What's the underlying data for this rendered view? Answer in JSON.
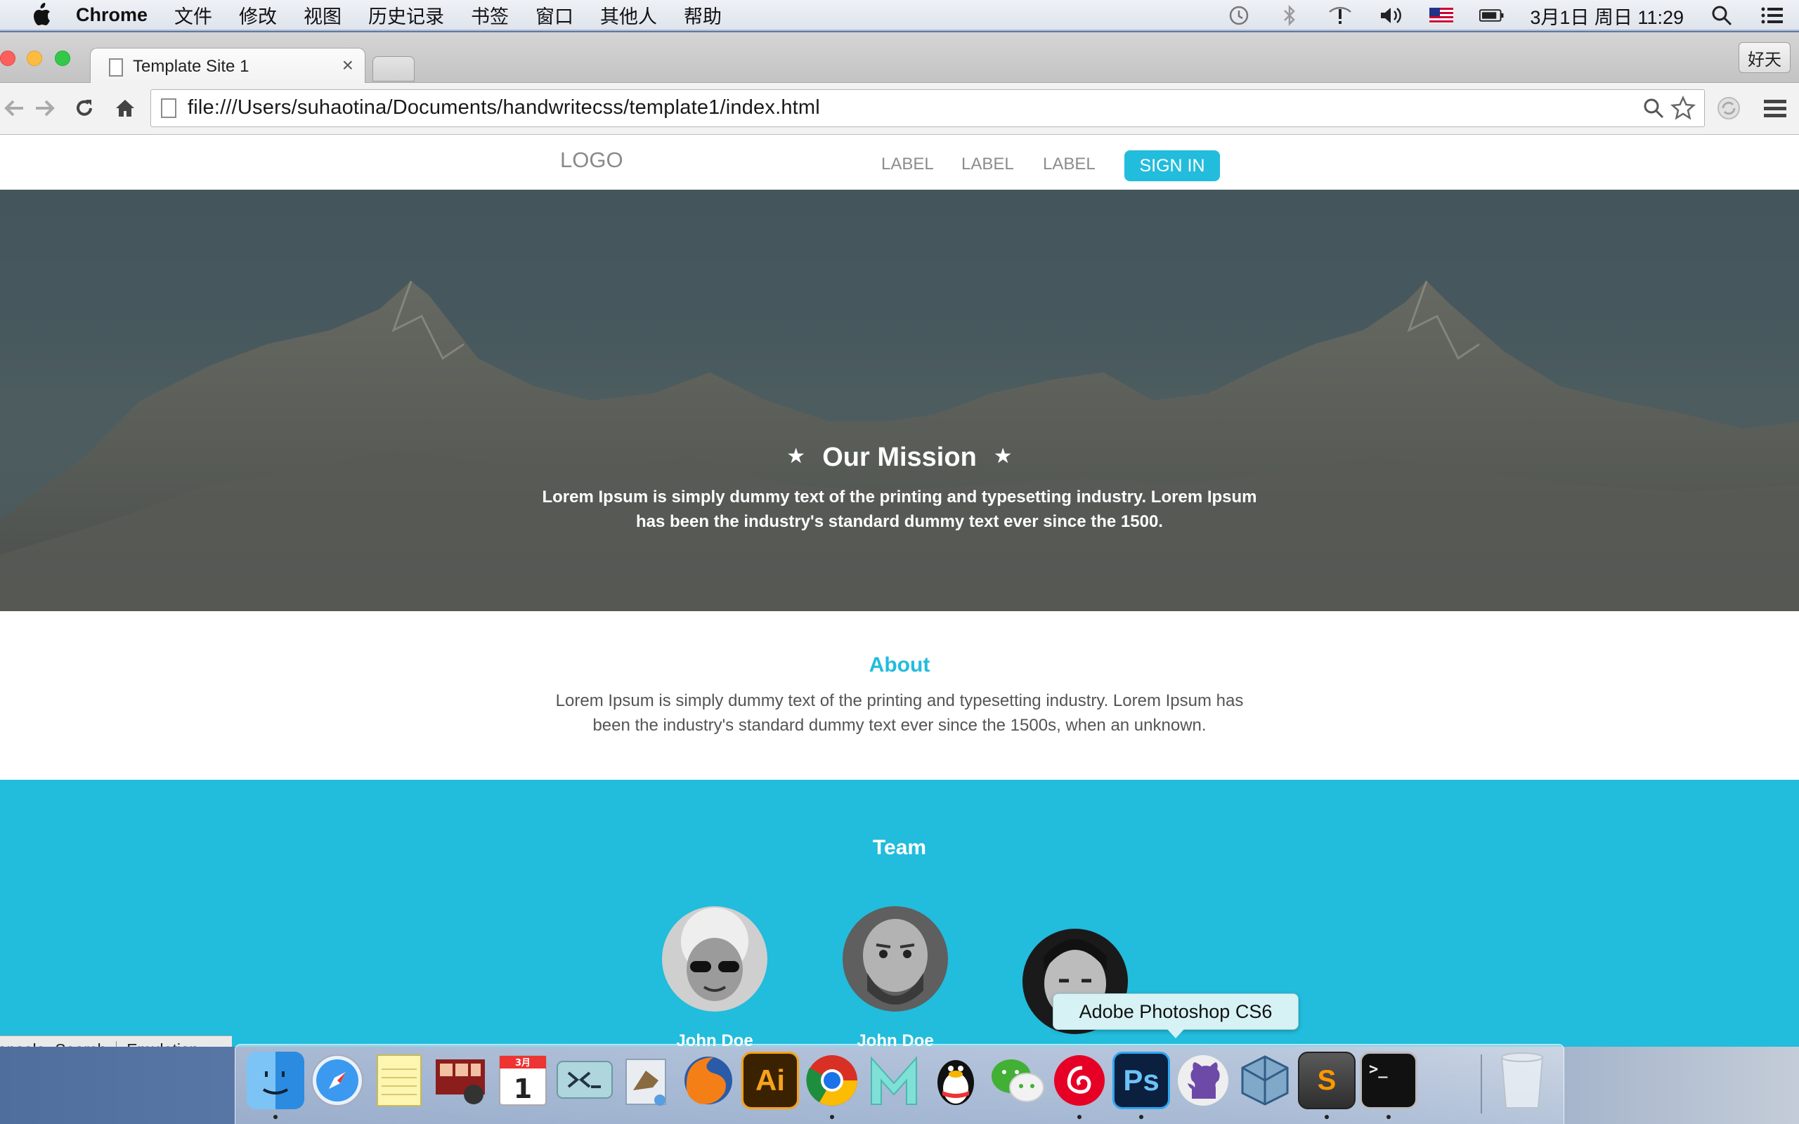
{
  "menubar": {
    "app_name": "Chrome",
    "items": [
      "文件",
      "修改",
      "视图",
      "历史记录",
      "书签",
      "窗口",
      "其他人",
      "帮助"
    ],
    "clock": "3月1日 周日 11:29"
  },
  "browser": {
    "tab_title": "Template Site 1",
    "profile_button": "好天",
    "url": "file:///Users/suhaotina/Documents/handwritecss/template1/index.html"
  },
  "site": {
    "logo": "LOGO",
    "nav": [
      "LABEL",
      "LABEL",
      "LABEL"
    ],
    "sign_in": "SIGN IN",
    "hero": {
      "title": "Our Mission",
      "text": "Lorem Ipsum is simply dummy text of the printing and typesetting industry. Lorem Ipsum has been the industry's standard dummy text ever since the 1500."
    },
    "about": {
      "title": "About",
      "text": "Lorem Ipsum is simply dummy text of the printing and typesetting industry. Lorem Ipsum has been the industry's standard dummy text ever since the 1500s, when an unknown."
    },
    "team": {
      "title": "Team",
      "members": [
        {
          "name": "John Doe"
        },
        {
          "name": "John Doe"
        },
        {
          "name": ""
        }
      ]
    }
  },
  "devtools": {
    "tabs": [
      "Console",
      "Search",
      "Emulation"
    ]
  },
  "dock": {
    "tooltip": "Adobe Photoshop CS6",
    "apps": [
      "Finder",
      "Safari",
      "Notes",
      "Photo Booth",
      "Calendar",
      "Screen Sharing",
      "Mail",
      "Firefox",
      "Illustrator",
      "Chrome",
      "MacDown",
      "QQ",
      "WeChat",
      "NetEase Music",
      "Photoshop",
      "GitHub",
      "VirtualBox",
      "Sublime Text",
      "Terminal",
      "Trash"
    ],
    "calendar_month": "3月",
    "calendar_day": "1",
    "illustrator_label": "Ai",
    "photoshop_label": "Ps",
    "terminal_prompt": ">_",
    "sublime_label": "S"
  },
  "colors": {
    "accent": "#22bcdc",
    "hero_overlay": "#3c4e54"
  }
}
